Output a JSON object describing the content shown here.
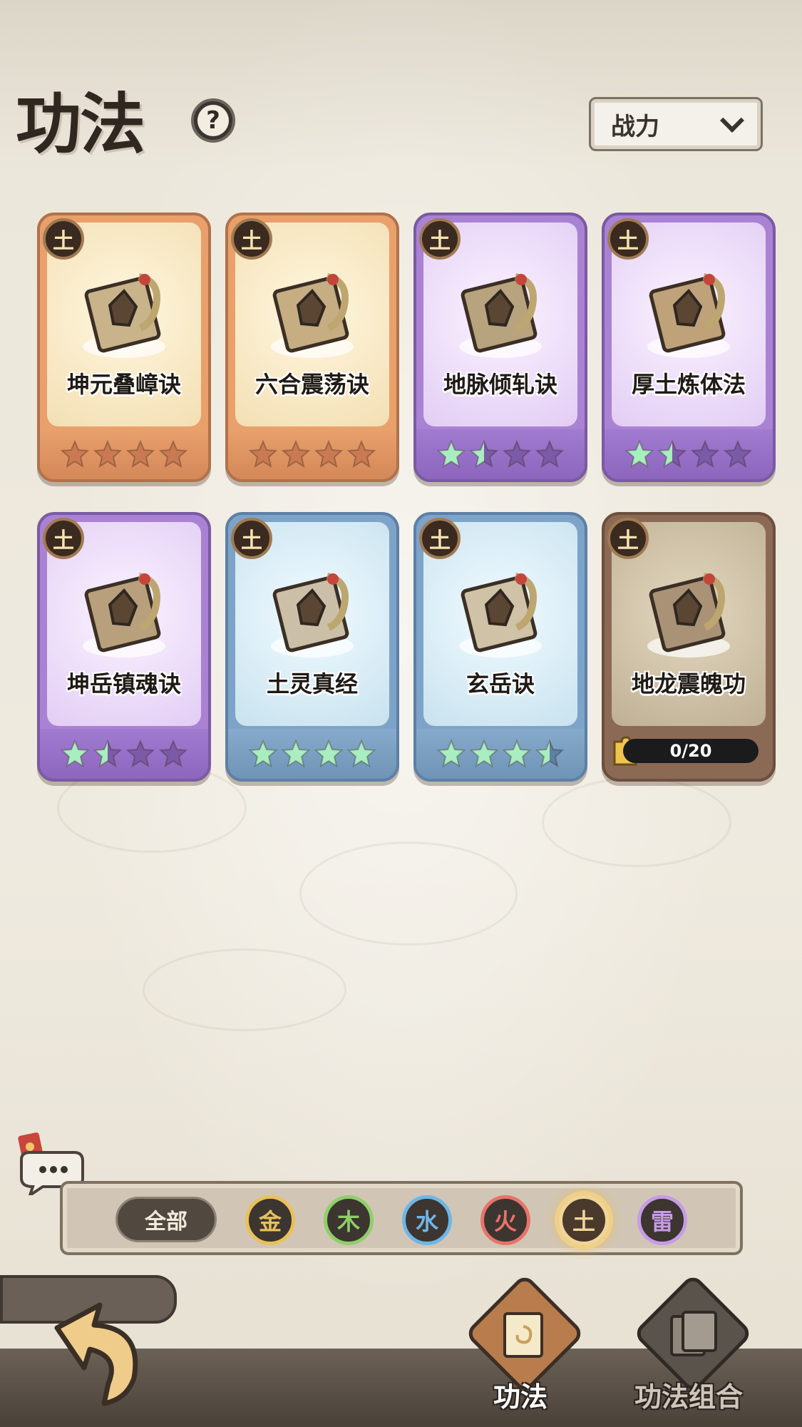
{
  "header": {
    "title": "功法",
    "help_label": "?"
  },
  "sort": {
    "selected": "战力"
  },
  "cards": [
    {
      "name": "坤元叠嶂诀",
      "element": "土",
      "rarity": "orange",
      "stars_lit": 0,
      "stars_total": 4
    },
    {
      "name": "六合震荡诀",
      "element": "土",
      "rarity": "orange",
      "stars_lit": 0,
      "stars_total": 4
    },
    {
      "name": "地脉倾轧诀",
      "element": "土",
      "rarity": "purple",
      "stars_lit": 1.5,
      "stars_total": 4
    },
    {
      "name": "厚土炼体法",
      "element": "土",
      "rarity": "purple",
      "stars_lit": 1.5,
      "stars_total": 4
    },
    {
      "name": "坤岳镇魂诀",
      "element": "土",
      "rarity": "purple",
      "stars_lit": 1.5,
      "stars_total": 4
    },
    {
      "name": "土灵真经",
      "element": "土",
      "rarity": "blue",
      "stars_lit": 4,
      "stars_total": 4
    },
    {
      "name": "玄岳诀",
      "element": "土",
      "rarity": "blue",
      "stars_lit": 3.5,
      "stars_total": 4
    },
    {
      "name": "地龙震魄功",
      "element": "土",
      "rarity": "locked",
      "progress_text": "0/20",
      "progress": 0
    }
  ],
  "filter": {
    "all_label": "全部",
    "elements": [
      {
        "label": "金",
        "color": "#e8c15a",
        "active": false
      },
      {
        "label": "木",
        "color": "#8fcf6a",
        "active": false
      },
      {
        "label": "水",
        "color": "#6fb6e6",
        "active": false
      },
      {
        "label": "火",
        "color": "#e8736a",
        "active": false
      },
      {
        "label": "土",
        "color": "#f0d59a",
        "active": true
      },
      {
        "label": "雷",
        "color": "#c79be6",
        "active": false
      }
    ]
  },
  "nav": {
    "tabs": [
      {
        "label": "功法",
        "active": true
      },
      {
        "label": "功法组合",
        "active": false
      }
    ]
  },
  "colors": {
    "star_lit": "#a8eec0",
    "star_dim_orange": "#c97a53",
    "star_dim_purple": "#7b5aa8"
  }
}
